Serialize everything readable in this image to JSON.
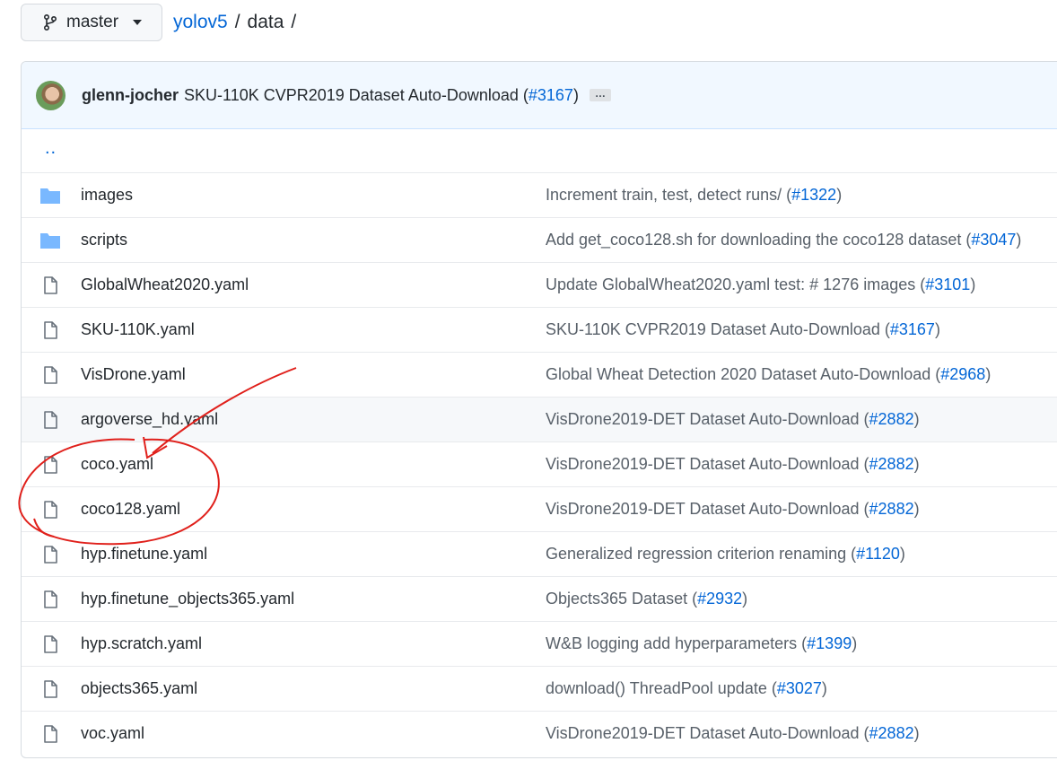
{
  "branch": {
    "label": "master"
  },
  "breadcrumb": {
    "repo": "yolov5",
    "sep1": "/",
    "folder": "data",
    "sep2": "/"
  },
  "latest_commit": {
    "author": "glenn-jocher",
    "message": "SKU-110K CVPR2019 Dataset Auto-Download (",
    "pr": "#3167",
    "close": ")",
    "more": "…"
  },
  "parent_dir": "..",
  "files": [
    {
      "type": "folder",
      "name": "images",
      "msg": "Increment train, test, detect runs/ (",
      "pr": "#1322",
      "close": ")"
    },
    {
      "type": "folder",
      "name": "scripts",
      "msg": "Add get_coco128.sh for downloading the coco128 dataset (",
      "pr": "#3047",
      "close": ")"
    },
    {
      "type": "file",
      "name": "GlobalWheat2020.yaml",
      "msg": "Update GlobalWheat2020.yaml test: # 1276 images (",
      "pr": "#3101",
      "close": ")"
    },
    {
      "type": "file",
      "name": "SKU-110K.yaml",
      "msg": "SKU-110K CVPR2019 Dataset Auto-Download (",
      "pr": "#3167",
      "close": ")"
    },
    {
      "type": "file",
      "name": "VisDrone.yaml",
      "msg": "Global Wheat Detection 2020 Dataset Auto-Download (",
      "pr": "#2968",
      "close": ")"
    },
    {
      "type": "file",
      "name": "argoverse_hd.yaml",
      "msg": "VisDrone2019-DET Dataset Auto-Download (",
      "pr": "#2882",
      "close": ")"
    },
    {
      "type": "file",
      "name": "coco.yaml",
      "msg": "VisDrone2019-DET Dataset Auto-Download (",
      "pr": "#2882",
      "close": ")"
    },
    {
      "type": "file",
      "name": "coco128.yaml",
      "msg": "VisDrone2019-DET Dataset Auto-Download (",
      "pr": "#2882",
      "close": ")"
    },
    {
      "type": "file",
      "name": "hyp.finetune.yaml",
      "msg": "Generalized regression criterion renaming (",
      "pr": "#1120",
      "close": ")"
    },
    {
      "type": "file",
      "name": "hyp.finetune_objects365.yaml",
      "msg": "Objects365 Dataset (",
      "pr": "#2932",
      "close": ")"
    },
    {
      "type": "file",
      "name": "hyp.scratch.yaml",
      "msg": "W&B logging add hyperparameters (",
      "pr": "#1399",
      "close": ")"
    },
    {
      "type": "file",
      "name": "objects365.yaml",
      "msg": "download() ThreadPool update (",
      "pr": "#3027",
      "close": ")"
    },
    {
      "type": "file",
      "name": "voc.yaml",
      "msg": "VisDrone2019-DET Dataset Auto-Download (",
      "pr": "#2882",
      "close": ")"
    }
  ],
  "colors": {
    "link": "#0366d6",
    "folder_icon": "#79b8ff",
    "annotation": "#e0201b"
  }
}
